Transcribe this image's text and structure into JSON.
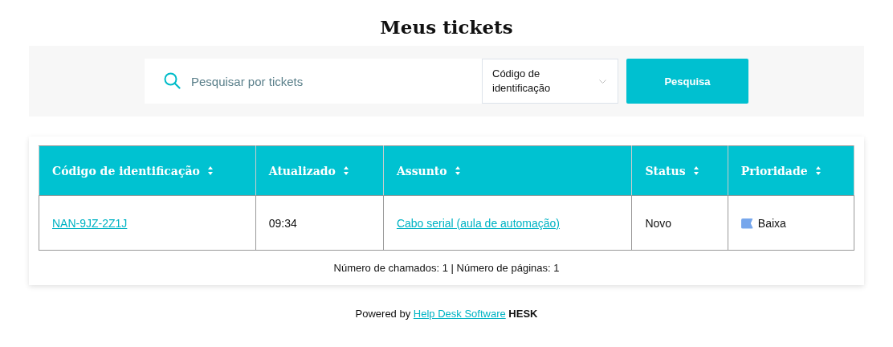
{
  "title": "Meus tickets",
  "search": {
    "placeholder": "Pesquisar por tickets",
    "filter": "Código de identificação",
    "button": "Pesquisa"
  },
  "table": {
    "columns": [
      "Código de identificação",
      "Atualizado",
      "Assunto",
      "Status",
      "Prioridade"
    ],
    "rows": [
      {
        "code": "NAN-9JZ-2Z1J",
        "updated": "09:34",
        "subject": "Cabo serial (aula de automação)",
        "status": "Novo",
        "priority": {
          "label": "Baixa",
          "color": "#77a7ec"
        }
      }
    ]
  },
  "summary": "Número de chamados: 1 | Número de páginas: 1",
  "footer": {
    "prefix": "Powered by",
    "link": "Help Desk Software",
    "brand": "HESK"
  }
}
